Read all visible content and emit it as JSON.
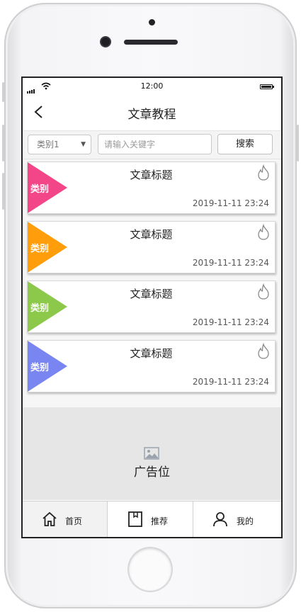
{
  "status_bar": {
    "time": "12:00"
  },
  "nav": {
    "title": "文章教程"
  },
  "search": {
    "category_value": "类别1",
    "placeholder": "请输入关键字",
    "button_label": "搜索"
  },
  "articles": [
    {
      "category": "类别",
      "title": "文章标题",
      "date": "2019-11-11 23:24",
      "color": "#f24688"
    },
    {
      "category": "类别",
      "title": "文章标题",
      "date": "2019-11-11 23:24",
      "color": "#ff9d0a"
    },
    {
      "category": "类别",
      "title": "文章标题",
      "date": "2019-11-11 23:24",
      "color": "#8cc94b"
    },
    {
      "category": "类别",
      "title": "文章标题",
      "date": "2019-11-11 23:24",
      "color": "#7985f0"
    }
  ],
  "ad": {
    "label": "广告位"
  },
  "tabs": [
    {
      "label": "首页",
      "icon": "home-icon"
    },
    {
      "label": "推荐",
      "icon": "bookmark-icon"
    },
    {
      "label": "我的",
      "icon": "user-icon"
    }
  ]
}
